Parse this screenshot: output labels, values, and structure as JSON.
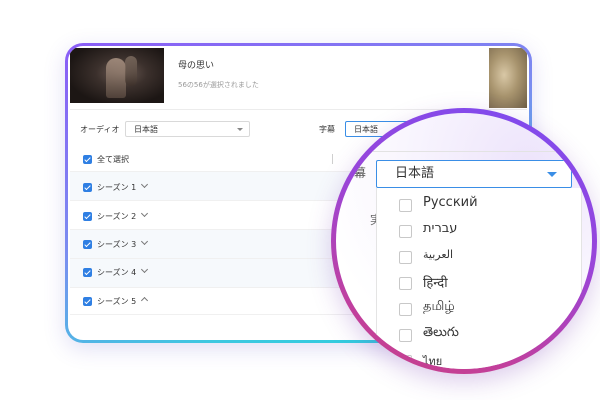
{
  "video": {
    "title": "母の思い",
    "status": "56の56が選択されました"
  },
  "audio": {
    "label": "オーディオ",
    "value": "日本語"
  },
  "subtitles": {
    "label": "字幕",
    "value": "日本語"
  },
  "select_all": {
    "label": "全て選択"
  },
  "seasons": [
    {
      "label": "シーズン 1",
      "expanded": false
    },
    {
      "label": "シーズン 2",
      "expanded": false
    },
    {
      "label": "シーズン 3",
      "expanded": false
    },
    {
      "label": "シーズン 4",
      "expanded": false
    },
    {
      "label": "シーズン 5",
      "expanded": true
    }
  ],
  "magnifier": {
    "edge_label": "幕",
    "edge_label_2": "実",
    "selected_value": "日本語",
    "options": [
      "Русский",
      "עברית",
      "العربية",
      "हिन्दी",
      "தமிழ்",
      "తెలుగు",
      "ไทย"
    ]
  },
  "colors": {
    "accent": "#2f7fe3",
    "ring_start": "#7b4cf2",
    "ring_end": "#c94284",
    "frame_start": "#8a5cf6",
    "frame_end": "#25d0dc"
  }
}
